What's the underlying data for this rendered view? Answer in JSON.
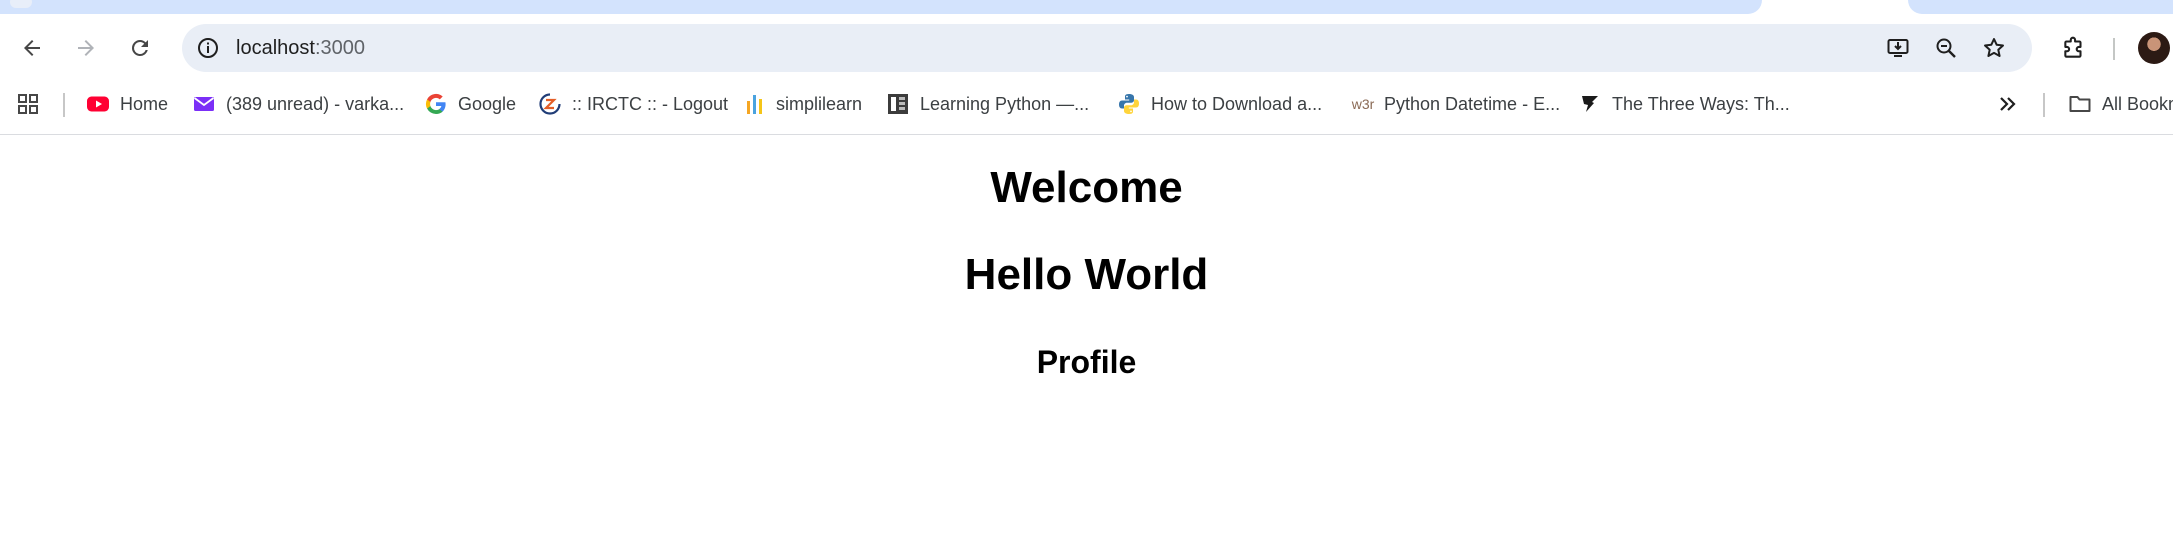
{
  "browser": {
    "address_bar": {
      "host": "localhost",
      "port": ":3000"
    },
    "bookmarks": [
      {
        "label": "Home",
        "icon": "youtube-icon"
      },
      {
        "label": "(389 unread) - varka...",
        "icon": "mail-icon"
      },
      {
        "label": "Google",
        "icon": "google-icon"
      },
      {
        "label": ":: IRCTC :: - Logout",
        "icon": "irctc-icon"
      },
      {
        "label": "simplilearn",
        "icon": "simplilearn-icon"
      },
      {
        "label": "Learning Python —...",
        "icon": "book-icon"
      },
      {
        "label": "How to Download a...",
        "icon": "python-icon"
      },
      {
        "label": "Python Datetime - E...",
        "icon": "w3r-icon",
        "icon_text": "w3r"
      },
      {
        "label": "The Three Ways: Th...",
        "icon": "flag-icon"
      }
    ],
    "all_bookmarks_label": "All Bookmarks",
    "colors": {
      "tab_strip": "#d3e3fd",
      "omnibox": "#e9eef6",
      "youtube": "#ff0033",
      "mail": "#7b2ff7"
    }
  },
  "page": {
    "heading_1": "Welcome",
    "heading_2": "Hello World",
    "heading_3": "Profile"
  }
}
